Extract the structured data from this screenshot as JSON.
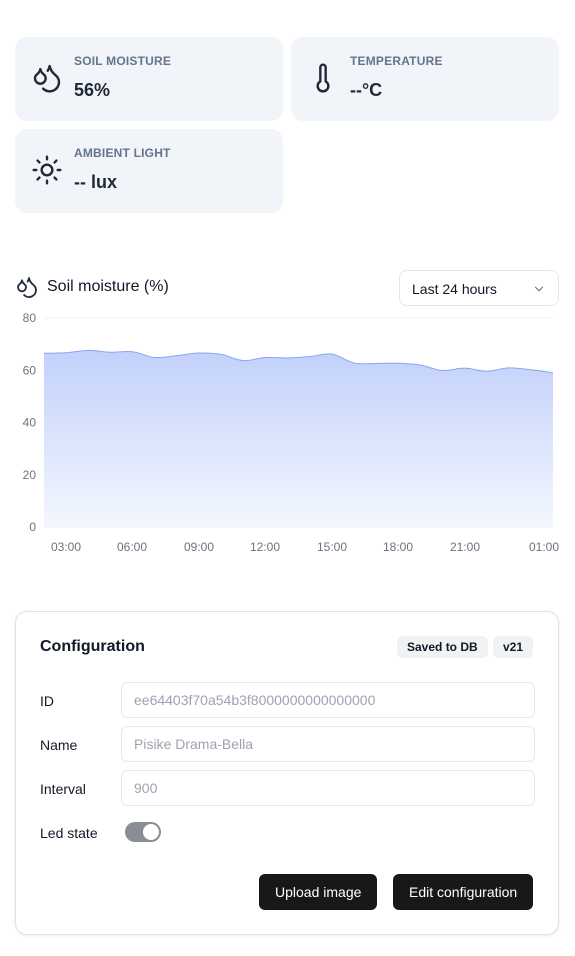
{
  "stats": {
    "soil_moisture": {
      "label": "SOIL MOISTURE",
      "value": "56%",
      "icon": "droplets-icon"
    },
    "temperature": {
      "label": "TEMPERATURE",
      "value": "--°C",
      "icon": "thermometer-icon"
    },
    "ambient_light": {
      "label": "AMBIENT LIGHT",
      "value": "-- lux",
      "icon": "sun-icon"
    }
  },
  "chart_header": {
    "title": "Soil moisture (%)",
    "icon": "droplets-icon",
    "range": {
      "selected": "Last 24 hours"
    }
  },
  "chart_data": {
    "type": "area",
    "title": "Soil moisture (%)",
    "xlabel": "",
    "ylabel": "",
    "ylim": [
      0,
      80
    ],
    "y_ticks": [
      0,
      20,
      40,
      60,
      80
    ],
    "x_tick_labels": [
      "03:00",
      "06:00",
      "09:00",
      "12:00",
      "15:00",
      "18:00",
      "21:00",
      "01:00"
    ],
    "grid": true,
    "series": [
      {
        "values": [
          66.5,
          66.7,
          67.6,
          66.9,
          67.1,
          64.9,
          65.6,
          66.6,
          66.1,
          63.7,
          64.9,
          64.7,
          65.2,
          66.2,
          62.8,
          62.6,
          62.7,
          62.0,
          59.9,
          60.8,
          59.6,
          60.9,
          60.2,
          59.0
        ]
      }
    ],
    "colors": {
      "line": "#8aa4f0",
      "fill_top": "#c2d1fb",
      "fill_bottom": "#f4f7fe",
      "grid": "#eceff3"
    }
  },
  "config": {
    "title": "Configuration",
    "badges": {
      "saved": "Saved to DB",
      "version": "v21"
    },
    "fields": {
      "id": {
        "label": "ID",
        "placeholder": "ee64403f70a54b3f8000000000000000"
      },
      "name": {
        "label": "Name",
        "placeholder": "Pisike Drama-Bella"
      },
      "interval": {
        "label": "Interval",
        "placeholder": "900"
      }
    },
    "led": {
      "label": "Led state",
      "enabled": true
    },
    "buttons": {
      "upload": "Upload image",
      "edit": "Edit configuration"
    }
  }
}
